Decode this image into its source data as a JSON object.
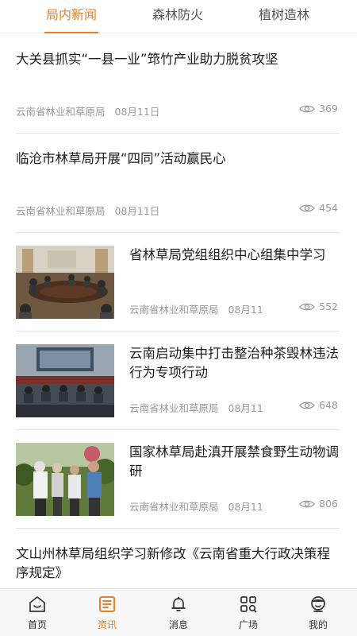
{
  "tabs": [
    {
      "label": "局内新闻",
      "active": true
    },
    {
      "label": "森林防火",
      "active": false
    },
    {
      "label": "植树造林",
      "active": false
    }
  ],
  "accent_color": "#e4822f",
  "news": [
    {
      "title": "大关县抓实“一县一业”筇竹产业助力脱贫攻坚",
      "source": "云南省林业和草原局",
      "date": "08月11日",
      "views": "369",
      "has_image": false
    },
    {
      "title": "临沧市林草局开展“四同”活动赢民心",
      "source": "云南省林业和草原局",
      "date": "08月11日",
      "views": "454",
      "has_image": false
    },
    {
      "title": "省林草局党组组织中心组集中学习",
      "source": "云南省林业和草原局",
      "date": "08月11",
      "views": "552",
      "has_image": true
    },
    {
      "title": "云南启动集中打击整治种茶毁林违法行为专项行动",
      "source": "云南省林业和草原局",
      "date": "08月11",
      "views": "648",
      "has_image": true
    },
    {
      "title": "国家林草局赴滇开展禁食野生动物调研",
      "source": "云南省林业和草原局",
      "date": "08月11",
      "views": "806",
      "has_image": true
    },
    {
      "title": "文山州林草局组织学习新修改《云南省重大行政决策程序规定》",
      "has_image": false
    }
  ],
  "bottom_nav": [
    {
      "label": "首页",
      "icon": "home-icon",
      "active": false
    },
    {
      "label": "资讯",
      "icon": "news-icon",
      "active": true
    },
    {
      "label": "消息",
      "icon": "bell-icon",
      "active": false
    },
    {
      "label": "广场",
      "icon": "grid-search-icon",
      "active": false
    },
    {
      "label": "我的",
      "icon": "profile-icon",
      "active": false
    }
  ]
}
